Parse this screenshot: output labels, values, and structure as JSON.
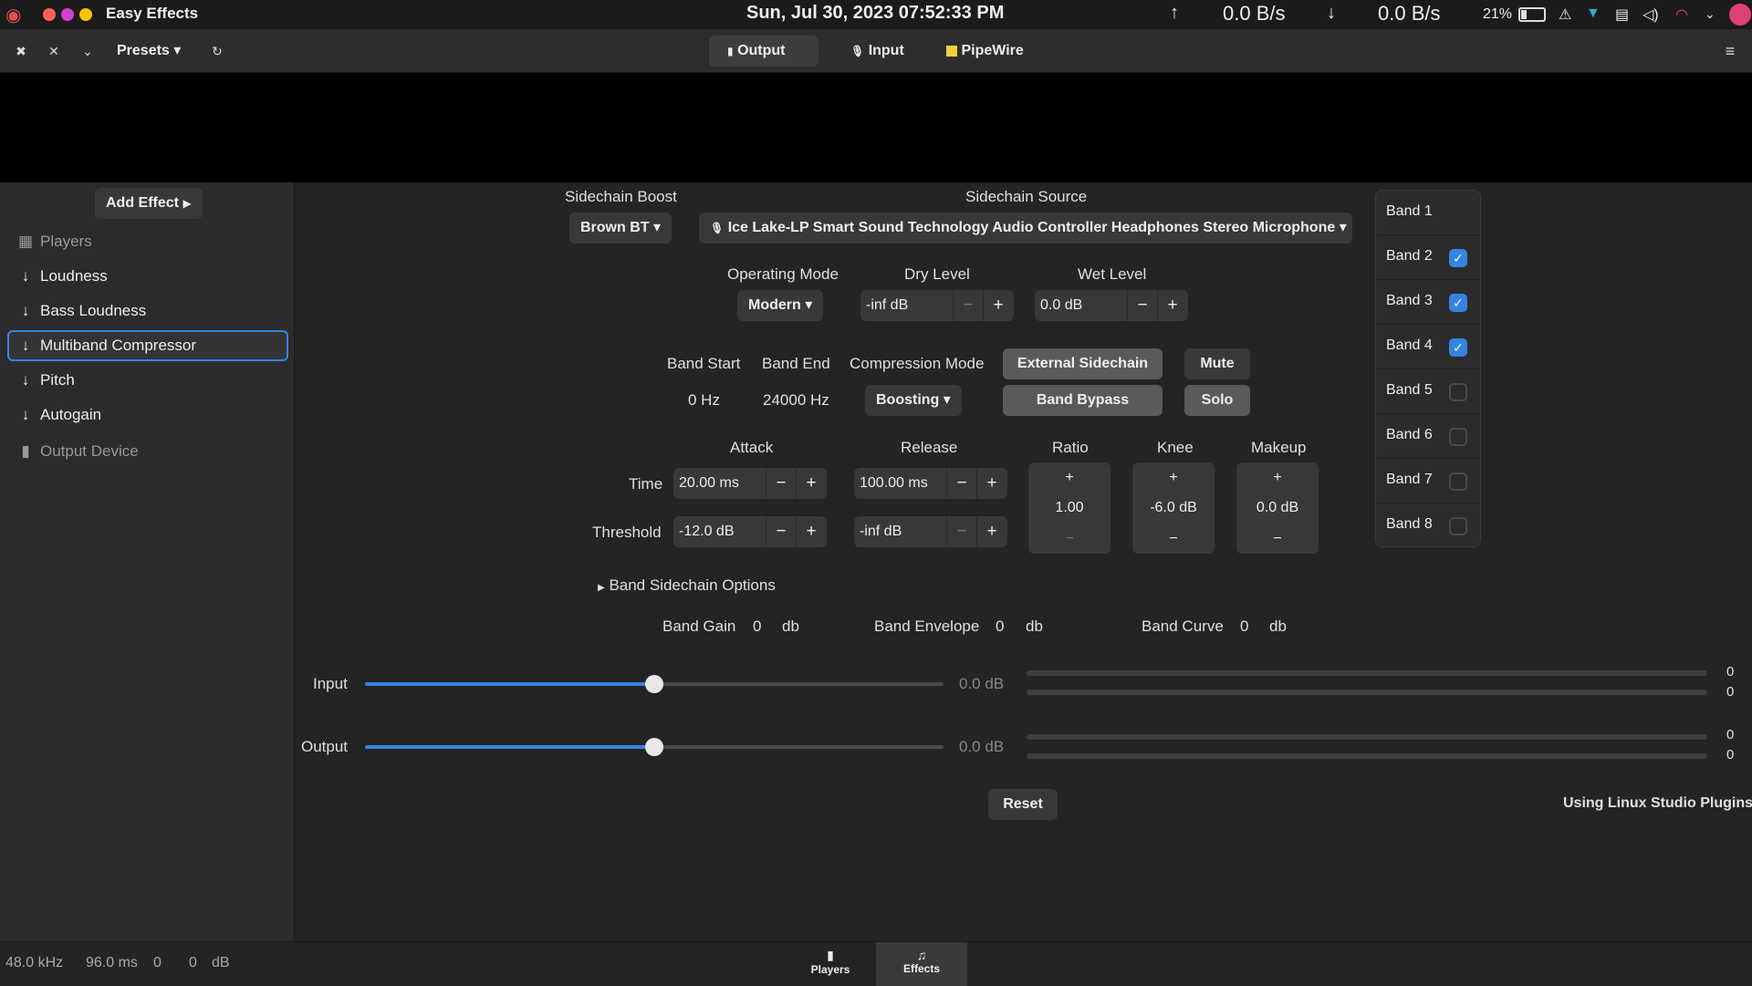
{
  "topbar": {
    "app_title": "Easy Effects",
    "datetime": "Sun, Jul 30, 2023  07:52:33 PM",
    "upload_rate": "0.0 B/s",
    "download_rate": "0.0 B/s",
    "battery_percent": "21%"
  },
  "header": {
    "presets_label": "Presets",
    "tabs": [
      {
        "label": "Output",
        "active": true
      },
      {
        "label": "Input",
        "active": false
      },
      {
        "label": "PipeWire",
        "active": false
      }
    ]
  },
  "sidebar": {
    "add_effect_label": "Add Effect",
    "items": [
      {
        "label": "Players",
        "dim": true
      },
      {
        "label": "Loudness"
      },
      {
        "label": "Bass Loudness"
      },
      {
        "label": "Multiband Compressor",
        "selected": true
      },
      {
        "label": "Pitch"
      },
      {
        "label": "Autogain"
      },
      {
        "label": "Output Device",
        "dim": true
      }
    ]
  },
  "sidechain": {
    "boost_label": "Sidechain Boost",
    "boost_value": "Brown BT",
    "source_label": "Sidechain Source",
    "source_value": "Ice Lake-LP Smart Sound Technology Audio Controller Headphones Stereo Microphone"
  },
  "mode": {
    "operating_label": "Operating Mode",
    "operating_value": "Modern",
    "dry_label": "Dry Level",
    "dry_value": "-inf dB",
    "wet_label": "Wet Level",
    "wet_value": "0.0 dB"
  },
  "band_info": {
    "start_label": "Band Start",
    "start_value": "0 Hz",
    "end_label": "Band End",
    "end_value": "24000 Hz",
    "compression_label": "Compression Mode",
    "compression_value": "Boosting",
    "external_sidechain": "External Sidechain",
    "band_bypass": "Band Bypass",
    "mute": "Mute",
    "solo": "Solo"
  },
  "dynamics": {
    "attack_label": "Attack",
    "release_label": "Release",
    "time_label": "Time",
    "threshold_label": "Threshold",
    "attack_time": "20.00 ms",
    "release_time": "100.00 ms",
    "attack_threshold": "-12.0 dB",
    "release_threshold": "-inf dB",
    "ratio_label": "Ratio",
    "ratio_value": "1.00",
    "knee_label": "Knee",
    "knee_value": "-6.0 dB",
    "makeup_label": "Makeup",
    "makeup_value": "0.0 dB"
  },
  "band_sidechain_options": "Band Sidechain Options",
  "readouts": {
    "gain_label": "Band Gain",
    "gain_value": "0",
    "envelope_label": "Band Envelope",
    "envelope_value": "0",
    "curve_label": "Band Curve",
    "curve_value": "0",
    "unit": "db"
  },
  "levels": {
    "input_label": "Input",
    "input_value": "0.0 dB",
    "input_fraction": 0.5,
    "output_label": "Output",
    "output_value": "0.0 dB",
    "output_fraction": 0.5,
    "meter_values": [
      "0",
      "0",
      "0",
      "0"
    ]
  },
  "reset_label": "Reset",
  "plugin_credit": "Using Linux Studio Plugins",
  "bands": [
    {
      "label": "Band 1",
      "checkbox": false,
      "checked": false
    },
    {
      "label": "Band 2",
      "checkbox": true,
      "checked": true
    },
    {
      "label": "Band 3",
      "checkbox": true,
      "checked": true
    },
    {
      "label": "Band 4",
      "checkbox": true,
      "checked": true
    },
    {
      "label": "Band 5",
      "checkbox": true,
      "checked": false
    },
    {
      "label": "Band 6",
      "checkbox": true,
      "checked": false
    },
    {
      "label": "Band 7",
      "checkbox": true,
      "checked": false
    },
    {
      "label": "Band 8",
      "checkbox": true,
      "checked": false
    }
  ],
  "status": {
    "sample_rate": "48.0 kHz",
    "latency": "96.0 ms",
    "value_a": "0",
    "value_b": "0",
    "unit": "dB",
    "tab_players": "Players",
    "tab_effects": "Effects"
  },
  "colors": {
    "accent": "#3584e4"
  }
}
